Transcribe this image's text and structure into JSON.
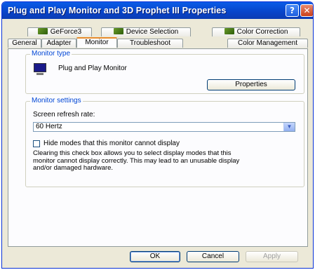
{
  "window": {
    "title": "Plug and Play Monitor and 3D Prophet III Properties",
    "help_glyph": "?",
    "close_glyph": "✕"
  },
  "tabs": {
    "row1": [
      {
        "label": "GeForce3"
      },
      {
        "label": "Device Selection"
      },
      {
        "label": "Color Correction"
      }
    ],
    "row2": [
      {
        "label": "General"
      },
      {
        "label": "Adapter"
      },
      {
        "label": "Monitor",
        "active": true
      },
      {
        "label": "Troubleshoot"
      },
      {
        "label": "Color Management"
      }
    ]
  },
  "monitor_type": {
    "group_label": "Monitor type",
    "monitor_name": "Plug and Play Monitor",
    "properties_button": "Properties"
  },
  "monitor_settings": {
    "group_label": "Monitor settings",
    "refresh_label": "Screen refresh rate:",
    "refresh_value": "60 Hertz",
    "hide_modes_label": "Hide modes that this monitor cannot display",
    "hide_modes_checked": false,
    "description_lines": [
      "Clearing this check box allows you to select display modes that this",
      "monitor cannot display correctly. This may lead to an unusable display",
      "and/or damaged hardware."
    ]
  },
  "footer": {
    "ok": "OK",
    "cancel": "Cancel",
    "apply": "Apply"
  }
}
